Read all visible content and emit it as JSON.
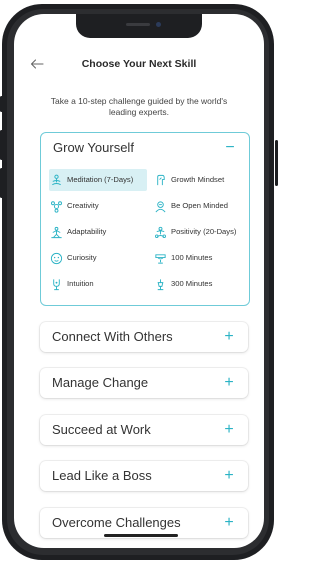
{
  "screen": {
    "title": "Choose Your Next Skill",
    "intro": "Take a 10-step challenge guided by the world's leading experts."
  },
  "colors": {
    "accent": "#2bb3c5",
    "accent_border": "#6fcbd8",
    "selected_bg": "#d8f0f4",
    "text": "#333333"
  },
  "categories": [
    {
      "label": "Grow Yourself",
      "expanded": true,
      "toggle": "−",
      "skills": [
        {
          "label": "Meditation (7-Days)",
          "icon": "meditation-icon",
          "selected": true
        },
        {
          "label": "Growth Mindset",
          "icon": "growth-mindset-icon",
          "selected": false
        },
        {
          "label": "Creativity",
          "icon": "creativity-icon",
          "selected": false
        },
        {
          "label": "Be Open Minded",
          "icon": "open-minded-icon",
          "selected": false
        },
        {
          "label": "Adaptability",
          "icon": "adaptability-icon",
          "selected": false
        },
        {
          "label": "Positivity (20-Days)",
          "icon": "positivity-icon",
          "selected": false
        },
        {
          "label": "Curiosity",
          "icon": "curiosity-icon",
          "selected": false
        },
        {
          "label": "100 Minutes",
          "icon": "hundred-minutes-icon",
          "selected": false
        },
        {
          "label": "Intuition",
          "icon": "intuition-icon",
          "selected": false
        },
        {
          "label": "300 Minutes",
          "icon": "three-hundred-minutes-icon",
          "selected": false
        }
      ]
    },
    {
      "label": "Connect With Others",
      "expanded": false,
      "toggle": "+"
    },
    {
      "label": "Manage Change",
      "expanded": false,
      "toggle": "+"
    },
    {
      "label": "Succeed at Work",
      "expanded": false,
      "toggle": "+"
    },
    {
      "label": "Lead Like a Boss",
      "expanded": false,
      "toggle": "+"
    },
    {
      "label": "Overcome Challenges",
      "expanded": false,
      "toggle": "+"
    }
  ]
}
